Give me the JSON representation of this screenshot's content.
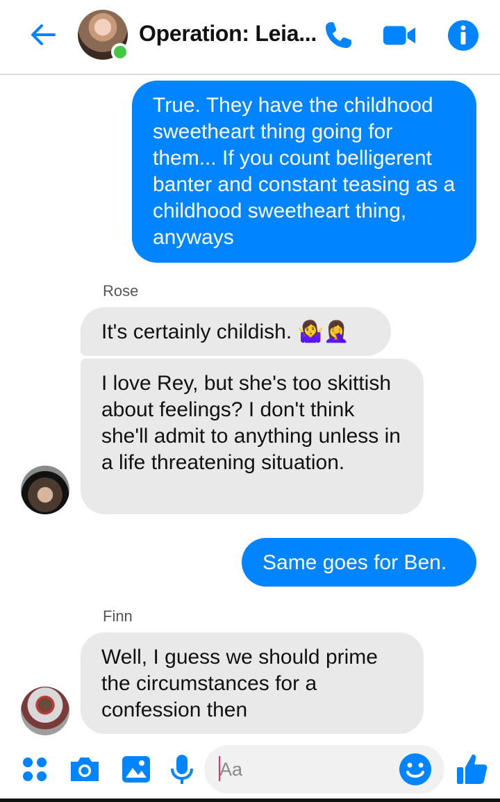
{
  "header": {
    "title": "Operation: Leia...",
    "back_icon": "back-arrow-icon",
    "call_icon": "phone-icon",
    "video_icon": "video-camera-icon",
    "info_icon": "info-icon",
    "accent": "#0084ff",
    "online_color": "#44c744"
  },
  "messages": [
    {
      "from": "me",
      "text": "True. They have the childhood sweetheart thing going for them... If you count belligerent banter and constant teasing as a childhood sweetheart thing, anyways"
    },
    {
      "sender": "Rose"
    },
    {
      "from": "Rose",
      "text": "It's certainly childish. 🤷‍♀️🤦‍♀️"
    },
    {
      "from": "Rose",
      "text": "I love Rey, but she's too skittish about feelings? I don't think she'll admit to anything unless in a life threatening situation."
    },
    {
      "from": "me",
      "text": "Same goes for Ben."
    },
    {
      "sender": "Finn"
    },
    {
      "from": "Finn",
      "text": "Well, I guess we should prime the circumstances for a confession then"
    }
  ],
  "composer": {
    "placeholder": "Aa",
    "icons": [
      "grid-menu-icon",
      "camera-icon",
      "gallery-icon",
      "microphone-icon",
      "emoji-icon",
      "thumbs-up-icon"
    ]
  }
}
